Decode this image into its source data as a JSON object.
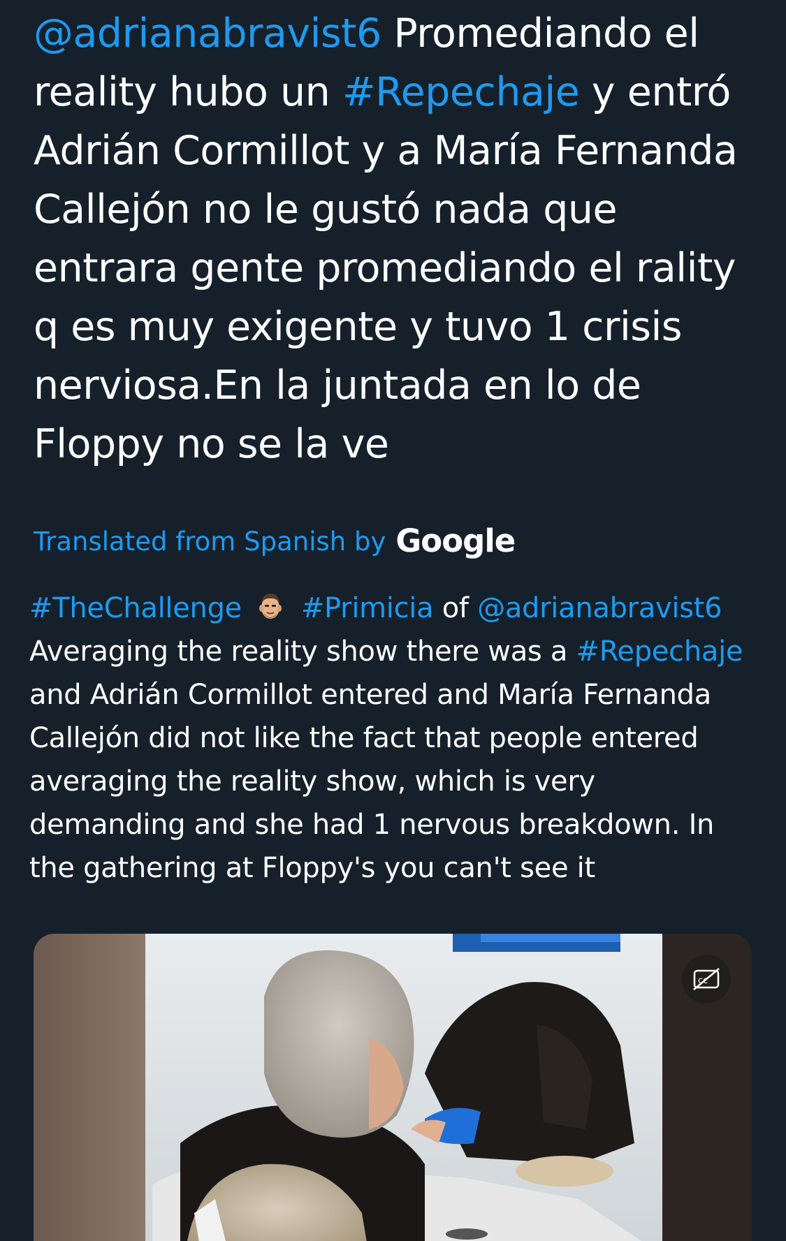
{
  "original_tweet": {
    "lines": [
      [
        {
          "t": "@adrianabravist6",
          "link": true
        },
        {
          "t": " Promediando el",
          "link": false
        }
      ],
      [
        {
          "t": "reality hubo un ",
          "link": false
        },
        {
          "t": "#Repechaje",
          "link": true
        },
        {
          "t": " y entró",
          "link": false
        }
      ],
      [
        {
          "t": "Adrián Cormillot y a María Fernanda",
          "link": false
        }
      ],
      [
        {
          "t": "Callejón no le gustó nada que",
          "link": false
        }
      ],
      [
        {
          "t": "entrara gente promediando el rality",
          "link": false
        }
      ],
      [
        {
          "t": "q es muy exigente y tuvo 1 crisis",
          "link": false
        }
      ],
      [
        {
          "t": "nerviosa.En la juntada en lo de",
          "link": false
        }
      ],
      [
        {
          "t": "Floppy no se la ve",
          "link": false
        }
      ]
    ]
  },
  "translation_credit": {
    "label": "Translated from Spanish by",
    "provider": "Google"
  },
  "translated_tweet": {
    "first_line": {
      "hashtag1": "#TheChallenge",
      "emoji": "face-emoji",
      "hashtag2": "#Primicia",
      "of": " of ",
      "mention": "@adrianabravist6"
    },
    "lines": [
      [
        {
          "t": "Averaging the reality show there was a ",
          "link": false
        },
        {
          "t": "#Repechaje",
          "link": true
        }
      ],
      [
        {
          "t": "and Adrián Cormillot entered and María Fernanda",
          "link": false
        }
      ],
      [
        {
          "t": "Callejón did not like the fact that people entered",
          "link": false
        }
      ],
      [
        {
          "t": "averaging the reality show, which is very",
          "link": false
        }
      ],
      [
        {
          "t": "demanding and she had 1 nervous breakdown. In",
          "link": false
        }
      ],
      [
        {
          "t": "the gathering at Floppy's you can't see it",
          "link": false
        }
      ]
    ]
  },
  "media": {
    "type": "video",
    "caption_button_icon": "closed-captions-icon"
  },
  "colors": {
    "background": "#15202b",
    "link": "#1d9bf0",
    "text": "#ffffff"
  }
}
